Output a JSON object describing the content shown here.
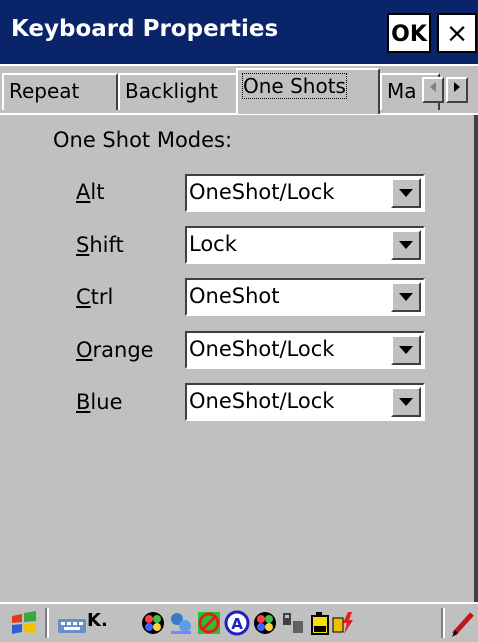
{
  "window": {
    "title": "Keyboard Properties",
    "ok_label": "OK",
    "close_label": "×"
  },
  "tabs": [
    {
      "label": "Repeat",
      "active": false
    },
    {
      "label": "Backlight",
      "active": false
    },
    {
      "label": "One Shots",
      "active": true
    },
    {
      "label": "Ma",
      "active": false
    }
  ],
  "tab_scroll": {
    "left_icon": "chevron-left-icon",
    "right_icon": "chevron-right-icon"
  },
  "group_label": "One Shot Modes:",
  "rows": [
    {
      "label_u": "A",
      "label_rest": "lt",
      "value": "OneShot/Lock"
    },
    {
      "label_u": "S",
      "label_rest": "hift",
      "value": "Lock"
    },
    {
      "label_u": "C",
      "label_rest": "trl",
      "value": "OneShot"
    },
    {
      "label_u": "O",
      "label_rest": "range",
      "value": "OneShot/Lock"
    },
    {
      "label_u": "B",
      "label_rest": "lue",
      "value": "OneShot/Lock"
    }
  ],
  "taskbar": {
    "icons": [
      "start-flag-icon",
      "keyboard-icon",
      "network-icon",
      "connection-icon",
      "no-signal-icon",
      "font-a-icon",
      "network-icon",
      "device-icon",
      "battery-icon",
      "power-icon",
      "pen-icon"
    ],
    "keyboard_label": "K."
  },
  "colors": {
    "titlebar": "#0a246a",
    "face": "#c0c0c0",
    "white": "#ffffff",
    "shadow": "#404040"
  }
}
